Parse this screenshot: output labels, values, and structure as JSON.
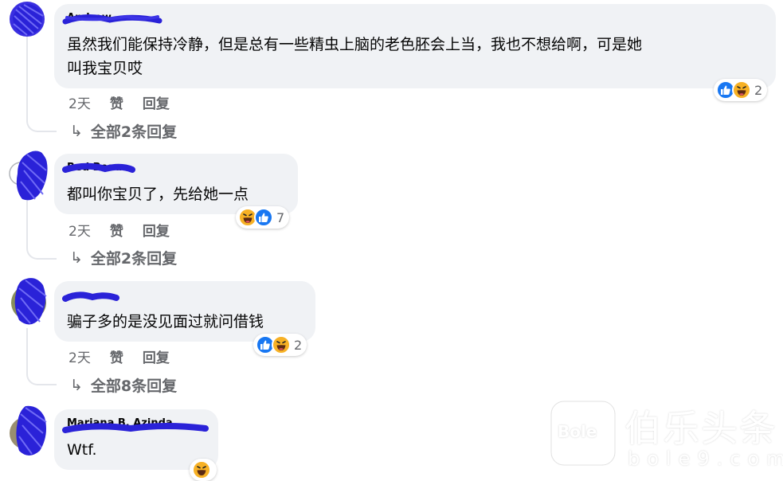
{
  "comments": [
    {
      "author": "Andrew",
      "text_lines": [
        "虽然我们能保持冷静，但是总有一些精虫上脑的老色胚会上当，我也不想给啊，可是她",
        "叫我宝贝哎"
      ],
      "reaction_icons": [
        "like-icon",
        "haha-icon"
      ],
      "reaction_count": "2",
      "time": "2天",
      "like_label": "赞",
      "reply_label": "回复",
      "view_replies": "全部2条回复"
    },
    {
      "author": "Red Beau",
      "text_lines": [
        "都叫你宝贝了，先给她一点"
      ],
      "reaction_icons": [
        "haha-icon",
        "like-icon"
      ],
      "reaction_count": "7",
      "time": "2天",
      "like_label": "赞",
      "reply_label": "回复",
      "view_replies": "全部2条回复"
    },
    {
      "author": "",
      "text_lines": [
        "骗子多的是没见面过就问借钱"
      ],
      "reaction_icons": [
        "like-icon",
        "haha-icon"
      ],
      "reaction_count": "2",
      "time": "2天",
      "like_label": "赞",
      "reply_label": "回复",
      "view_replies": "全部8条回复"
    },
    {
      "author": "Mariana B. Azinda",
      "text_lines": [
        "Wtf."
      ],
      "reaction_icons": [
        "haha-icon"
      ]
    }
  ],
  "reply_arrow": "↳",
  "watermark": {
    "logo_text": "Bole",
    "cn_text": "伯乐头条",
    "url_text": "bole9.com"
  },
  "colors": {
    "bubble": "#f0f2f5",
    "secondary_text": "#65676b",
    "like_blue": "#1877f2",
    "haha_yellow": "#f7b125",
    "scribble_blue": "#2a22d8"
  }
}
